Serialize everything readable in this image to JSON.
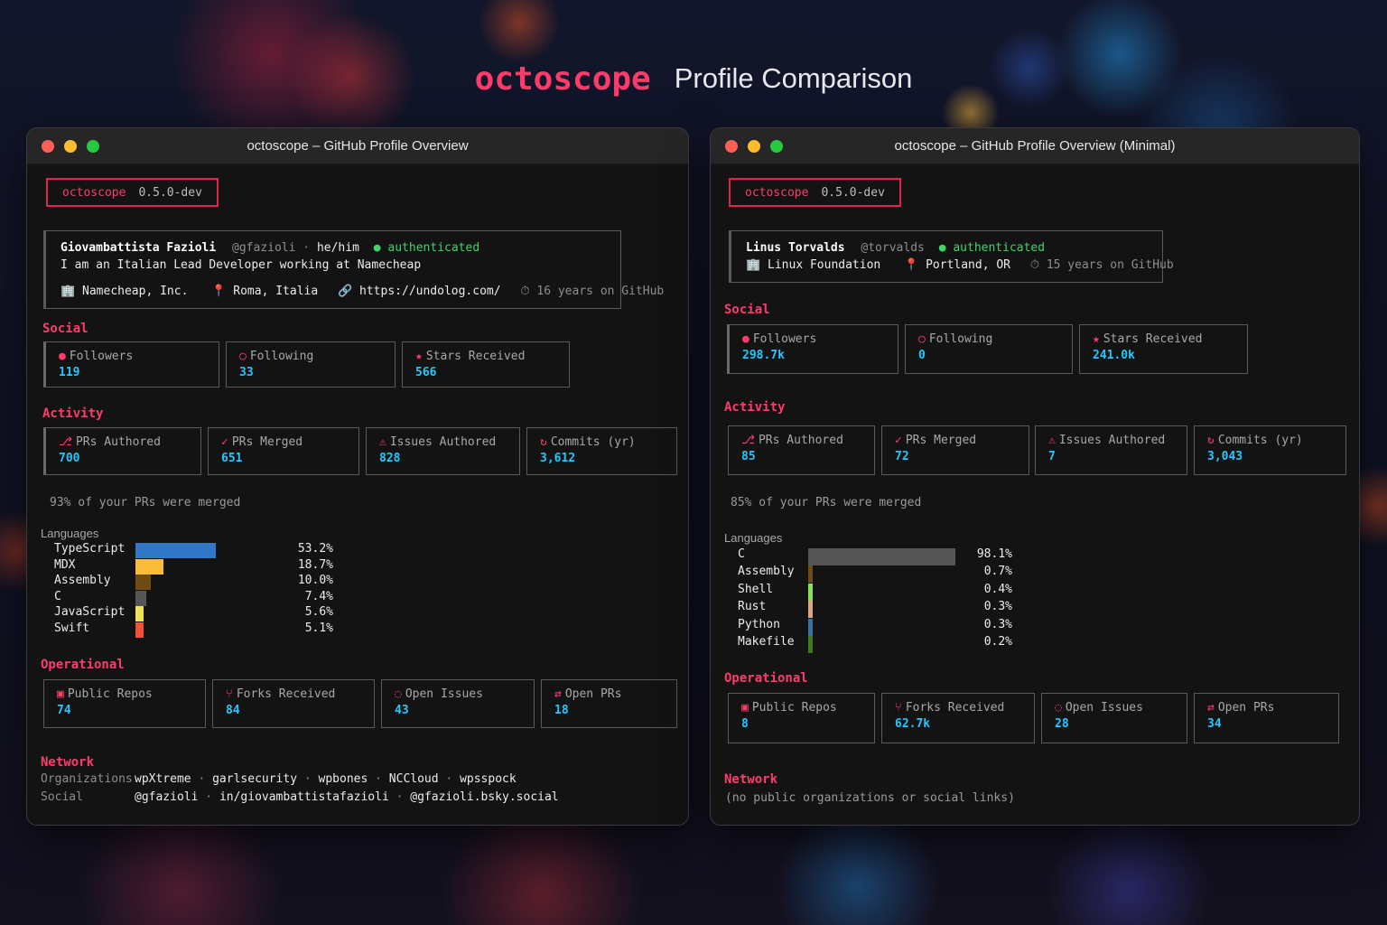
{
  "header": {
    "brand": "octoscope",
    "subtitle": "Profile Comparison"
  },
  "left": {
    "window_title": "octoscope – GitHub Profile Overview",
    "badge": {
      "name": "octoscope",
      "version": "0.5.0-dev"
    },
    "profile": {
      "name": "Giovambattista Fazioli",
      "handle": "@gfazioli",
      "pronouns": "he/him",
      "status": "authenticated",
      "bio": "I am an Italian Lead Developer working at Namecheap",
      "company": "Namecheap, Inc.",
      "location": "Roma, Italia",
      "website": "https://undolog.com/",
      "tenure": "16 years on GitHub"
    },
    "sections": {
      "social": "Social",
      "activity": "Activity",
      "operational": "Operational",
      "network": "Network",
      "languages": "Languages"
    },
    "social": [
      {
        "icon": "●",
        "label": "Followers",
        "value": "119"
      },
      {
        "icon": "○",
        "label": "Following",
        "value": "33"
      },
      {
        "icon": "★",
        "label": "Stars Received",
        "value": "566"
      }
    ],
    "activity": [
      {
        "icon": "⎇",
        "label": "PRs Authored",
        "value": "700"
      },
      {
        "icon": "✓",
        "label": "PRs Merged",
        "value": "651"
      },
      {
        "icon": "⚠",
        "label": "Issues Authored",
        "value": "828"
      },
      {
        "icon": "↻",
        "label": "Commits (yr)",
        "value": "3,612"
      }
    ],
    "merge_note": "93% of your PRs were merged",
    "languages": [
      {
        "name": "TypeScript",
        "pct": "53.2%",
        "share": 53.2,
        "color": "#3178c6"
      },
      {
        "name": "MDX",
        "pct": "18.7%",
        "share": 18.7,
        "color": "#f9bc3a"
      },
      {
        "name": "Assembly",
        "pct": "10.0%",
        "share": 10.0,
        "color": "#6e4c13"
      },
      {
        "name": "C",
        "pct": "7.4%",
        "share": 7.4,
        "color": "#555555"
      },
      {
        "name": "JavaScript",
        "pct": "5.6%",
        "share": 5.6,
        "color": "#f1e05a"
      },
      {
        "name": "Swift",
        "pct": "5.1%",
        "share": 5.1,
        "color": "#f05138"
      }
    ],
    "operational": [
      {
        "icon": "▣",
        "label": "Public Repos",
        "value": "74"
      },
      {
        "icon": "⑂",
        "label": "Forks Received",
        "value": "84"
      },
      {
        "icon": "◌",
        "label": "Open Issues",
        "value": "43"
      },
      {
        "icon": "⇄",
        "label": "Open PRs",
        "value": "18"
      }
    ],
    "network": {
      "org_label": "Organizations",
      "orgs": [
        "wpXtreme",
        "garlsecurity",
        "wpbones",
        "NCCloud",
        "wpsspock"
      ],
      "social_label": "Social",
      "socials": [
        "@gfazioli",
        "in/giovambattistafazioli",
        "@gfazioli.bsky.social"
      ]
    }
  },
  "right": {
    "window_title": "octoscope – GitHub Profile Overview (Minimal)",
    "badge": {
      "name": "octoscope",
      "version": "0.5.0-dev"
    },
    "profile": {
      "name": "Linus Torvalds",
      "handle": "@torvalds",
      "status": "authenticated",
      "company": "Linux Foundation",
      "location": "Portland, OR",
      "tenure": "15 years on GitHub"
    },
    "sections": {
      "social": "Social",
      "activity": "Activity",
      "operational": "Operational",
      "network": "Network",
      "languages": "Languages"
    },
    "social": [
      {
        "icon": "●",
        "label": "Followers",
        "value": "298.7k"
      },
      {
        "icon": "○",
        "label": "Following",
        "value": "0"
      },
      {
        "icon": "★",
        "label": "Stars Received",
        "value": "241.0k"
      }
    ],
    "activity": [
      {
        "icon": "⎇",
        "label": "PRs Authored",
        "value": "85"
      },
      {
        "icon": "✓",
        "label": "PRs Merged",
        "value": "72"
      },
      {
        "icon": "⚠",
        "label": "Issues Authored",
        "value": "7"
      },
      {
        "icon": "↻",
        "label": "Commits (yr)",
        "value": "3,043"
      }
    ],
    "merge_note": "85% of your PRs were merged",
    "languages": [
      {
        "name": "C",
        "pct": "98.1%",
        "share": 98.1,
        "color": "#555555"
      },
      {
        "name": "Assembly",
        "pct": "0.7%",
        "share": 0.7,
        "color": "#6e4c13"
      },
      {
        "name": "Shell",
        "pct": "0.4%",
        "share": 0.4,
        "color": "#89e051"
      },
      {
        "name": "Rust",
        "pct": "0.3%",
        "share": 0.3,
        "color": "#dea584"
      },
      {
        "name": "Python",
        "pct": "0.3%",
        "share": 0.3,
        "color": "#3572a5"
      },
      {
        "name": "Makefile",
        "pct": "0.2%",
        "share": 0.2,
        "color": "#427819"
      }
    ],
    "operational": [
      {
        "icon": "▣",
        "label": "Public Repos",
        "value": "8"
      },
      {
        "icon": "⑂",
        "label": "Forks Received",
        "value": "62.7k"
      },
      {
        "icon": "◌",
        "label": "Open Issues",
        "value": "28"
      },
      {
        "icon": "⇄",
        "label": "Open PRs",
        "value": "34"
      }
    ],
    "network": {
      "empty": "(no public organizations or social links)"
    }
  }
}
